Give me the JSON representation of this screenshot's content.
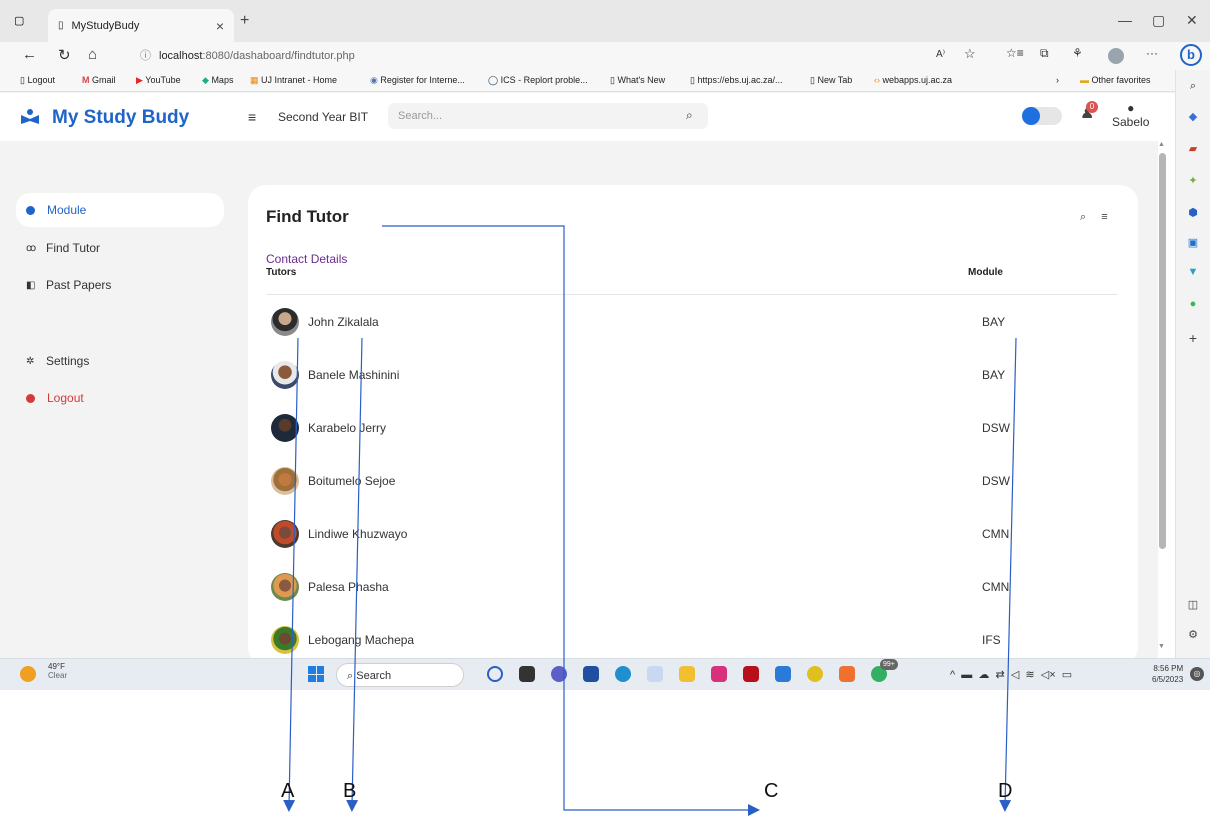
{
  "browser": {
    "tab_title": "MyStudyBudy",
    "tab_close": "×",
    "new_tab": "+",
    "url_host": "localhost",
    "url_path": ":8080/dashaboard/findtutor.php",
    "bookmarks": [
      "Logout",
      "Gmail",
      "YouTube",
      "Maps",
      "UJ Intranet - Home",
      "Register for Interne...",
      "ICS - Replort proble...",
      "What's New",
      "https://ebs.uj.ac.za/...",
      "New Tab",
      "webapps.uj.ac.za",
      "Other favorites"
    ]
  },
  "app": {
    "brand": "My Study Budy",
    "course": "Second Year BIT",
    "search_placeholder": "Search...",
    "notification_count": "0",
    "user_name": "Sabelo"
  },
  "sidebar": {
    "items": [
      {
        "label": "Module"
      },
      {
        "label": "Find Tutor"
      },
      {
        "label": "Past Papers"
      },
      {
        "label": "Settings"
      },
      {
        "label": "Logout"
      }
    ]
  },
  "card": {
    "title": "Find Tutor",
    "subtitle": "Contact Details",
    "columns": [
      "Tutors",
      "Module"
    ],
    "rows": [
      {
        "name": "John Zikalala",
        "module": "BAY"
      },
      {
        "name": "Banele Mashinini",
        "module": "BAY"
      },
      {
        "name": "Karabelo Jerry",
        "module": "DSW"
      },
      {
        "name": "Boitumelo Sejoe",
        "module": "DSW"
      },
      {
        "name": "Lindiwe Khuzwayo",
        "module": "CMN"
      },
      {
        "name": "Palesa Phasha",
        "module": "CMN"
      },
      {
        "name": "Lebogang Machepa",
        "module": "IFS"
      }
    ]
  },
  "taskbar": {
    "temp": "49°F",
    "condition": "Clear",
    "search": "Search",
    "badge": "99+",
    "time": "8:56 PM",
    "date": "6/5/2023"
  },
  "annotations": [
    "A",
    "B",
    "C",
    "D"
  ],
  "colors": {
    "brand": "#1f64c8",
    "accent_purple": "#6a2c91",
    "logout_red": "#d33b3b",
    "annotation_line": "#2b5fc4"
  }
}
